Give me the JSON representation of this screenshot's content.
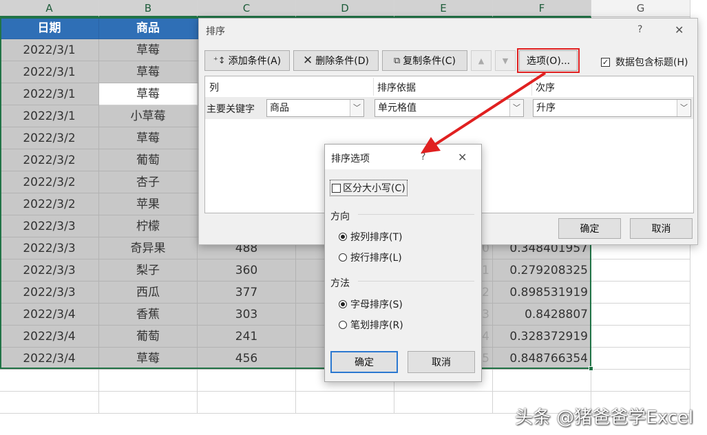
{
  "sheet": {
    "columns": [
      "A",
      "B",
      "C",
      "D",
      "E",
      "F",
      "G"
    ],
    "header_row": [
      "日期",
      "商品"
    ],
    "rows": [
      {
        "date": "2022/3/1",
        "item": "草莓",
        "c": "",
        "e": "",
        "f": ""
      },
      {
        "date": "2022/3/1",
        "item": "草莓",
        "c": "",
        "e": "",
        "f": ""
      },
      {
        "date": "2022/3/1",
        "item": "草莓",
        "c": "",
        "e": "",
        "f": ""
      },
      {
        "date": "2022/3/1",
        "item": "小草莓",
        "c": "",
        "e": "",
        "f": ""
      },
      {
        "date": "2022/3/2",
        "item": "草莓",
        "c": "",
        "e": "",
        "f": ""
      },
      {
        "date": "2022/3/2",
        "item": "葡萄",
        "c": "",
        "e": "",
        "f": ""
      },
      {
        "date": "2022/3/2",
        "item": "杏子",
        "c": "",
        "e": "",
        "f": ""
      },
      {
        "date": "2022/3/2",
        "item": "苹果",
        "c": "",
        "e": "",
        "f": ""
      },
      {
        "date": "2022/3/3",
        "item": "柠檬",
        "c": "",
        "e": "",
        "f": ""
      },
      {
        "date": "2022/3/3",
        "item": "奇异果",
        "c": "488",
        "e": "0",
        "f": "0.348401957"
      },
      {
        "date": "2022/3/3",
        "item": "梨子",
        "c": "360",
        "e": "1",
        "f": "0.279208325"
      },
      {
        "date": "2022/3/3",
        "item": "西瓜",
        "c": "377",
        "e": "2",
        "f": "0.898531919"
      },
      {
        "date": "2022/3/4",
        "item": "香蕉",
        "c": "303",
        "e": "3",
        "f": "0.8428807"
      },
      {
        "date": "2022/3/4",
        "item": "葡萄",
        "c": "241",
        "e": "4",
        "f": "0.328372919"
      },
      {
        "date": "2022/3/4",
        "item": "草莓",
        "c": "456",
        "e": "5",
        "f": "0.848766354"
      }
    ]
  },
  "sort_dialog": {
    "title": "排序",
    "help": "?",
    "close": "✕",
    "add_condition": "添加条件(A)",
    "delete_condition": "删除条件(D)",
    "copy_condition": "复制条件(C)",
    "move_up": "▲",
    "move_down": "▼",
    "options": "选项(O)...",
    "has_headers": "数据包含标题(H)",
    "grid_headers": {
      "column": "列",
      "sort_on": "排序依据",
      "order": "次序"
    },
    "primary_key_label": "主要关键字",
    "column_value": "商品",
    "sort_on_value": "单元格值",
    "order_value": "升序",
    "ok": "确定",
    "cancel": "取消"
  },
  "options_dialog": {
    "title": "排序选项",
    "help": "?",
    "close": "✕",
    "case_sensitive": "区分大小写(C)",
    "direction_label": "方向",
    "by_column": "按列排序(T)",
    "by_row": "按行排序(L)",
    "method_label": "方法",
    "by_letter": "字母排序(S)",
    "by_stroke": "笔划排序(R)",
    "ok": "确定",
    "cancel": "取消"
  },
  "watermark": "头条 @猪爸爸学Excel",
  "colors": {
    "header_blue": "#2f6fb6",
    "selection_green": "#217346",
    "highlight_red": "#e02020"
  }
}
